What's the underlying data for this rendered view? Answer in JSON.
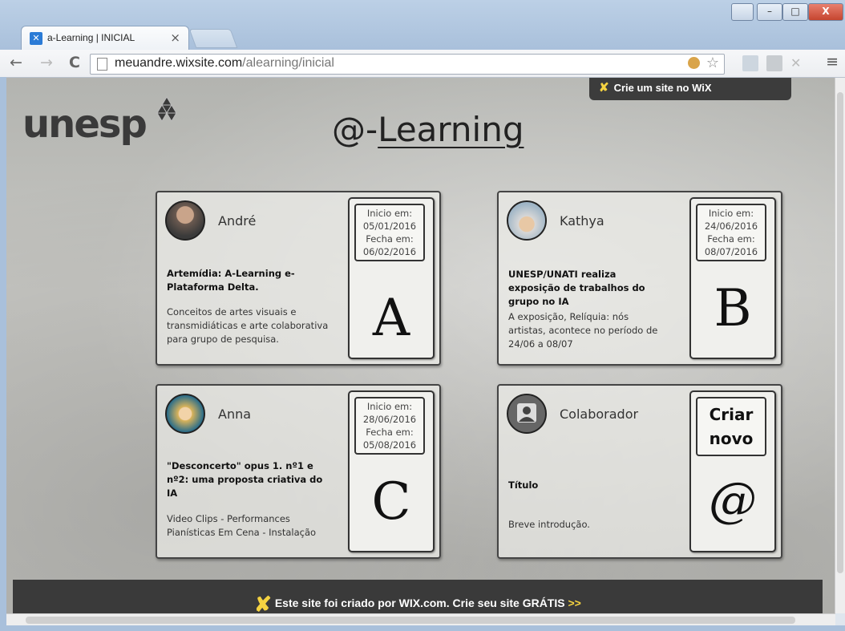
{
  "browser": {
    "tab_title": "a-Learning | INICIAL",
    "tab_close": "×",
    "url_host": "meuandre.wixsite.com",
    "url_path": "/alearning/inicial",
    "back": "←",
    "forward": "→",
    "reload": "C",
    "star": "☆",
    "menu": "≡",
    "window_buttons": [
      "–",
      "□",
      "X"
    ]
  },
  "page": {
    "logo_text": "unesp",
    "title_prefix": "@-",
    "title_underlined": "Learning",
    "wix_top_banner": "Crie um site no WiX",
    "wix_bottom_banner_a": "Este site foi criado por WIX.com. Crie seu site GRÁTIS",
    "wix_bottom_banner_b": ">>"
  },
  "cards": [
    {
      "name": "André",
      "start_label": "Inicio em:",
      "start_date": "05/01/2016",
      "end_label": "Fecha em:",
      "end_date": "06/02/2016",
      "title": "Artemídia: A-Learning e-Plataforma Delta.",
      "description": "Conceitos de artes visuais e transmidiáticas e arte colaborativa para grupo de pesquisa.",
      "letter": "A"
    },
    {
      "name": "Kathya",
      "start_label": "Inicio em:",
      "start_date": "24/06/2016",
      "end_label": "Fecha em:",
      "end_date": "08/07/2016",
      "title": "UNESP/UNATI realiza exposição de trabalhos do grupo no IA",
      "description": "A exposição, Relíquia: nós artistas, acontece no período de 24/06 a 08/07",
      "letter": "B"
    },
    {
      "name": "Anna",
      "start_label": "Inicio em:",
      "start_date": "28/06/2016",
      "end_label": "Fecha em:",
      "end_date": "05/08/2016",
      "title": "\"Desconcerto\" opus 1. nº1 e nº2: uma proposta criativa do IA",
      "description": "Video Clips - Performances Pianísticas Em Cena - Instalação",
      "letter": "C"
    },
    {
      "name": "Colaborador",
      "button_line1": "Criar",
      "button_line2": "novo",
      "title": "Título",
      "description": "Breve introdução.",
      "letter": "@"
    }
  ]
}
